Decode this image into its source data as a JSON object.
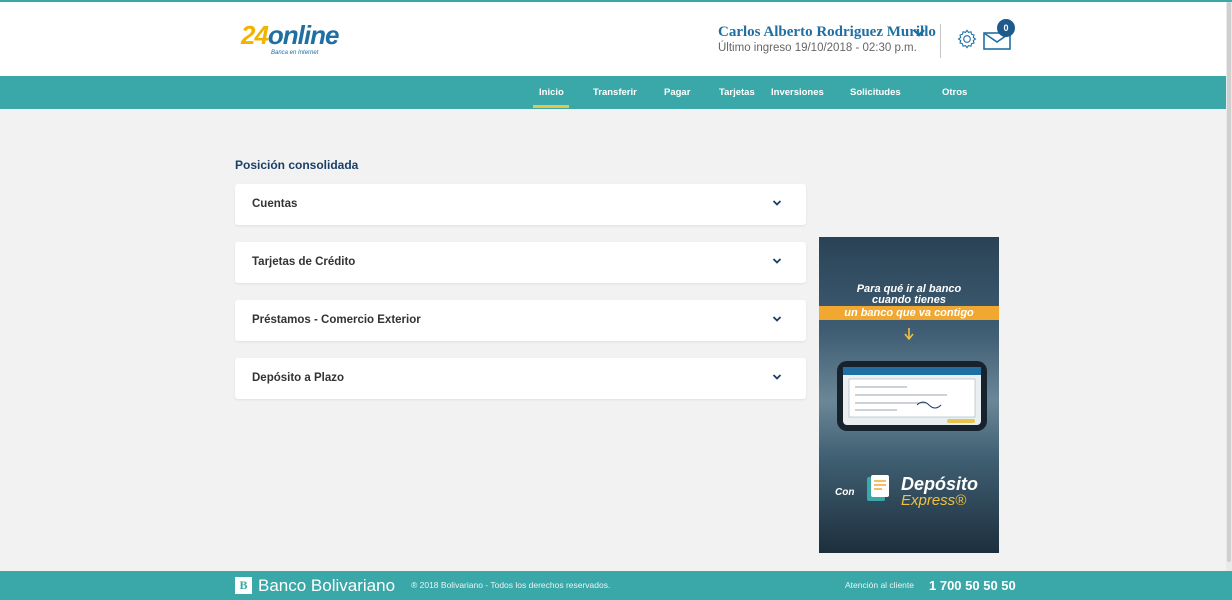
{
  "brand": {
    "logo_number": "24",
    "logo_word": "online",
    "logo_sub": "Banca en Internet"
  },
  "user": {
    "name": "Carlos Alberto Rodriguez Murillo",
    "last_login": "Último ingreso 19/10/2018 - 02:30 p.m.",
    "messages_count": "0"
  },
  "nav": {
    "items": [
      {
        "label": "Inicio"
      },
      {
        "label": "Transferir"
      },
      {
        "label": "Pagar"
      },
      {
        "label": "Tarjetas"
      },
      {
        "label": "Inversiones"
      },
      {
        "label": "Solicitudes"
      },
      {
        "label": "Otros"
      }
    ],
    "active_index": 0
  },
  "main": {
    "title": "Posición consolidada",
    "accordions": [
      {
        "label": "Cuentas"
      },
      {
        "label": "Tarjetas de Crédito"
      },
      {
        "label": "Préstamos - Comercio Exterior"
      },
      {
        "label": "Depósito a Plazo"
      }
    ]
  },
  "ad": {
    "line1": "Para qué ir al banco",
    "line2": "cuando tienes",
    "line3": "un banco que va contigo",
    "con": "Con",
    "product": "Depósito",
    "product_sub": "Express®"
  },
  "footer": {
    "brand_initial": "B",
    "brand": "Banco Bolivariano",
    "copyright": "® 2018 Bolivariano - Todos los derechos reservados.",
    "attention_label": "Atención al cliente",
    "phone": "1 700 50 50 50"
  },
  "colors": {
    "teal": "#3aa8a8",
    "navy": "#1a3f66",
    "brand_blue": "#1f6fa3",
    "active_underline": "#e8c44a",
    "ad_orange": "#f0a830"
  }
}
